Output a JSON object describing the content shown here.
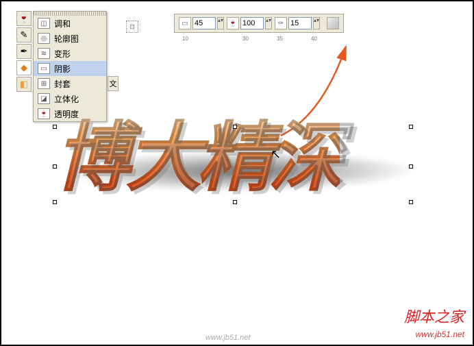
{
  "toolbox": {
    "tools": [
      "wineglass-icon",
      "eyedropper-icon",
      "pen-icon",
      "blend-icon",
      "pattern-icon"
    ]
  },
  "flyout": {
    "items": [
      {
        "label": "调和",
        "icon": "◫"
      },
      {
        "label": "轮廓图",
        "icon": "◎"
      },
      {
        "label": "变形",
        "icon": "≋"
      },
      {
        "label": "阴影",
        "icon": "▭",
        "highlight": true
      },
      {
        "label": "封套",
        "icon": "⊞"
      },
      {
        "label": "立体化",
        "icon": "◪"
      },
      {
        "label": "透明度",
        "icon": "🍷"
      }
    ],
    "extra": "文"
  },
  "propbar": {
    "angle": "45",
    "opacity": "100",
    "feather": "15"
  },
  "ruler": {
    "t1": "10",
    "t2": "30",
    "t3": "35",
    "t4": "40"
  },
  "canvas": {
    "text": "博大精深"
  },
  "footer": {
    "site": "脚本之家",
    "url": "www.jb51.net",
    "url2": "www.jb51.net"
  }
}
